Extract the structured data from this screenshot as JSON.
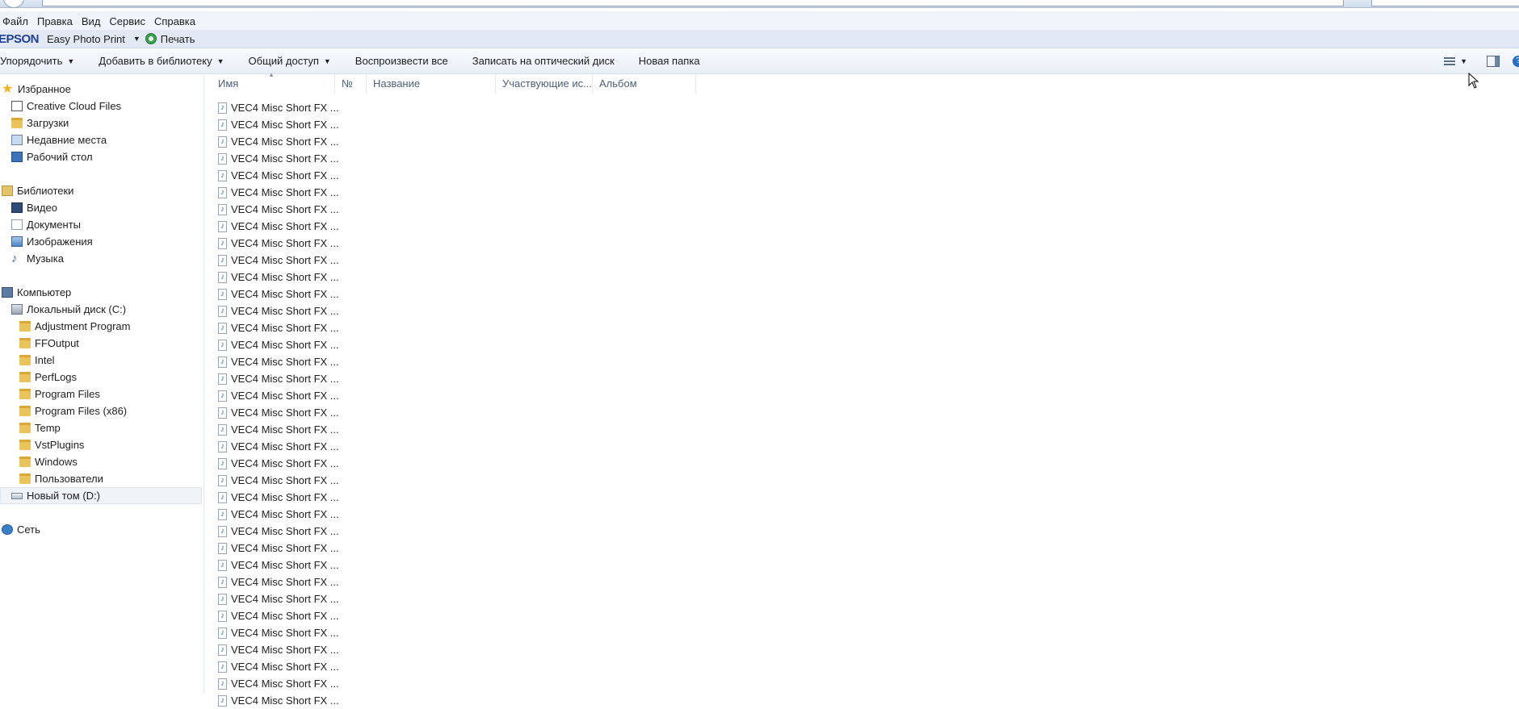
{
  "menu": [
    "Файл",
    "Правка",
    "Вид",
    "Сервис",
    "Справка"
  ],
  "epson": {
    "logo": "EPSON",
    "app": "Easy Photo Print",
    "print": "Печать"
  },
  "commands": {
    "organize": "Упорядочить",
    "add_library": "Добавить в библиотеку",
    "share": "Общий доступ",
    "play_all": "Воспроизвести все",
    "burn": "Записать на оптический диск",
    "new_folder": "Новая папка"
  },
  "sidebar": {
    "favorites": "Избранное",
    "creative_cloud": "Creative Cloud Files",
    "downloads": "Загрузки",
    "recent": "Недавние места",
    "desktop": "Рабочий стол",
    "libraries": "Библиотеки",
    "video": "Видео",
    "documents": "Документы",
    "images": "Изображения",
    "music": "Музыка",
    "computer": "Компьютер",
    "disk_c": "Локальный диск (C:)",
    "folders": [
      "Adjustment Program",
      "FFOutput",
      "Intel",
      "PerfLogs",
      "Program Files",
      "Program Files (x86)",
      "Temp",
      "VstPlugins",
      "Windows",
      "Пользователи"
    ],
    "disk_d": "Новый том (D:)",
    "network": "Сеть"
  },
  "columns": {
    "name": "Имя",
    "number": "№",
    "title": "Название",
    "artists": "Участвующие ис...",
    "album": "Альбом"
  },
  "files": [
    "VEC4 Misc Short FX ...",
    "VEC4 Misc Short FX ...",
    "VEC4 Misc Short FX ...",
    "VEC4 Misc Short FX ...",
    "VEC4 Misc Short FX ...",
    "VEC4 Misc Short FX ...",
    "VEC4 Misc Short FX ...",
    "VEC4 Misc Short FX ...",
    "VEC4 Misc Short FX ...",
    "VEC4 Misc Short FX ...",
    "VEC4 Misc Short FX ...",
    "VEC4 Misc Short FX ...",
    "VEC4 Misc Short FX ...",
    "VEC4 Misc Short FX ...",
    "VEC4 Misc Short FX ...",
    "VEC4 Misc Short FX ...",
    "VEC4 Misc Short FX ...",
    "VEC4 Misc Short FX ...",
    "VEC4 Misc Short FX ...",
    "VEC4 Misc Short FX ...",
    "VEC4 Misc Short FX ...",
    "VEC4 Misc Short FX ...",
    "VEC4 Misc Short FX ...",
    "VEC4 Misc Short FX ...",
    "VEC4 Misc Short FX ...",
    "VEC4 Misc Short FX ...",
    "VEC4 Misc Short FX ...",
    "VEC4 Misc Short FX ...",
    "VEC4 Misc Short FX ...",
    "VEC4 Misc Short FX ...",
    "VEC4 Misc Short FX ...",
    "VEC4 Misc Short FX ...",
    "VEC4 Misc Short FX ...",
    "VEC4 Misc Short FX ...",
    "VEC4 Misc Short FX ...",
    "VEC4 Misc Short FX ..."
  ]
}
